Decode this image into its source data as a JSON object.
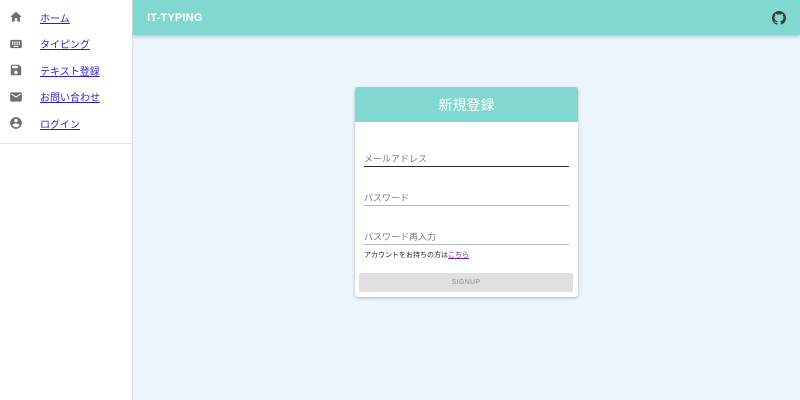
{
  "sidebar": {
    "items": [
      {
        "label": "ホーム",
        "icon": "home-icon"
      },
      {
        "label": "タイピング",
        "icon": "keyboard-icon"
      },
      {
        "label": "テキスト登録",
        "icon": "save-icon"
      },
      {
        "label": "お問い合わせ",
        "icon": "mail-icon"
      },
      {
        "label": "ログイン",
        "icon": "account-circle-icon"
      }
    ]
  },
  "appbar": {
    "title": "IT-TYPING",
    "icon": "github-icon"
  },
  "signup_form": {
    "title": "新規登録",
    "email_placeholder": "メールアドレス",
    "email_value": "",
    "password_placeholder": "パスワード",
    "password_value": "",
    "password_confirm_placeholder": "パスワード再入力",
    "password_confirm_value": "",
    "account_prompt": "アカウントをお持ちの方は",
    "account_link": "こちら",
    "submit_label": "SIGNUP"
  },
  "colors": {
    "accent": "#80d8d0",
    "background": "#ecf5fe",
    "link": "#2a1fd0",
    "disabled_button": "#e0e0e0"
  }
}
